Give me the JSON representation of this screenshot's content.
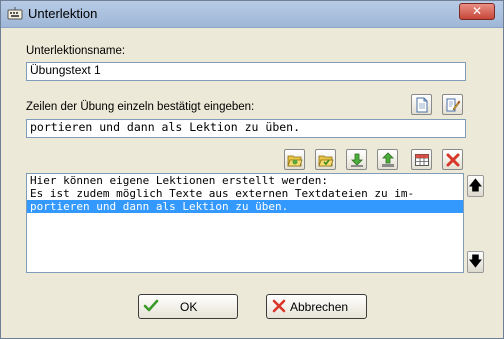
{
  "window": {
    "title": "Unterlektion"
  },
  "name_section": {
    "label": "Unterlektionsname:",
    "value": "Übungstext 1"
  },
  "line_section": {
    "label": "Zeilen der Übung einzeln bestätigt eingeben:",
    "value": "portieren und dann als Lektion zu üben."
  },
  "list": {
    "lines": [
      "Hier können eigene Lektionen erstellt werden:",
      "Es ist zudem möglich Texte aus externen Textdateien zu im-",
      "portieren und dann als Lektion zu üben."
    ]
  },
  "buttons": {
    "ok": "OK",
    "cancel": "Abbrechen"
  },
  "colors": {
    "selection": "#3399ff",
    "window_bg": "#ece9d8",
    "titlebar": "#b7cbe6",
    "delete_red": "#d9362b"
  }
}
